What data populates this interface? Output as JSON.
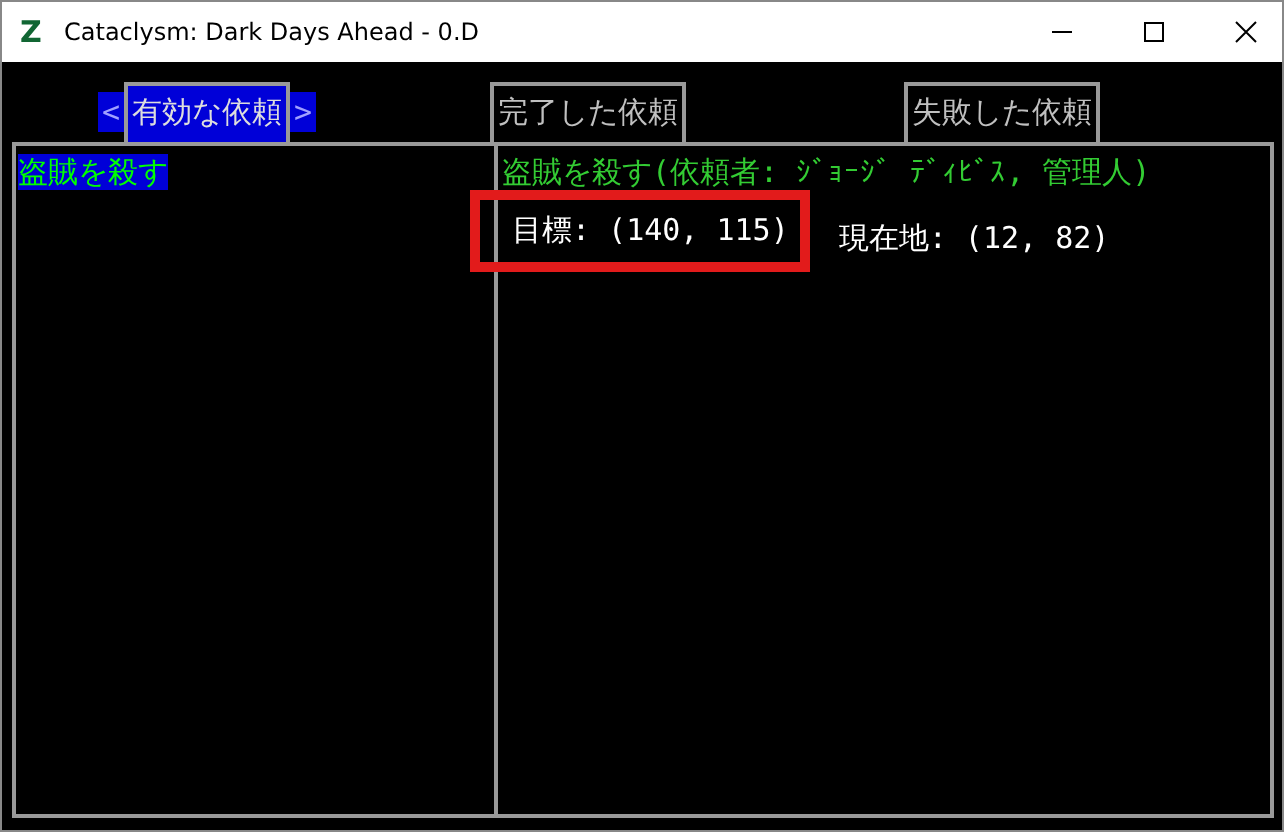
{
  "window": {
    "title": "Cataclysm: Dark Days Ahead - 0.D",
    "logo": "Z"
  },
  "tabs": [
    {
      "label": "有効な依頼",
      "selected": true,
      "prev": "<",
      "next": ">"
    },
    {
      "label": "完了した依頼",
      "selected": false
    },
    {
      "label": "失敗した依頼",
      "selected": false
    }
  ],
  "missions": [
    {
      "name": "盗賊を殺す",
      "selected": true
    }
  ],
  "detail": {
    "title": "盗賊を殺す(依頼者: ｼﾞｮｰｼﾞ ﾃﾞｨﾋﾞｽ, 管理人)",
    "target": "目標: (140, 115)",
    "target_highlighted": true,
    "location": "現在地: (12, 82)"
  }
}
